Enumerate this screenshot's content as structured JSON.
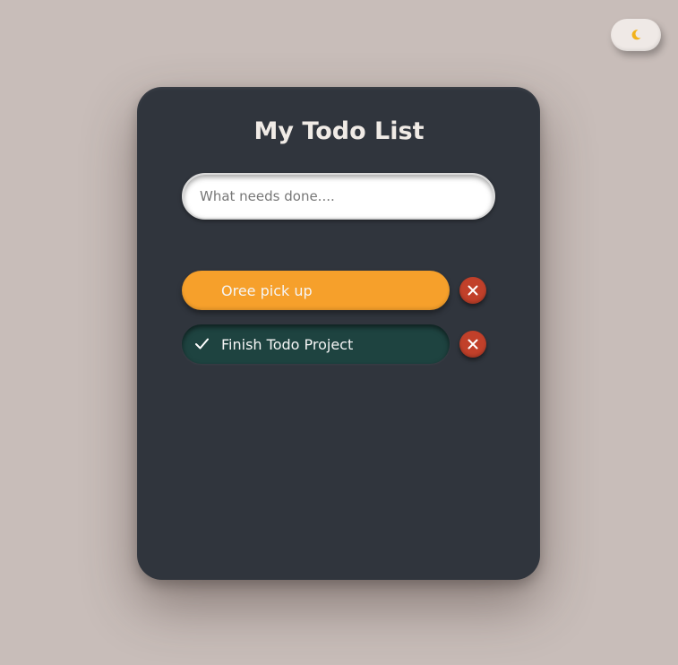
{
  "app": {
    "title": "My Todo List"
  },
  "theme_toggle": {
    "icon": "moon-icon",
    "icon_color": "#f2b21b"
  },
  "input": {
    "placeholder": "What needs done....",
    "value": ""
  },
  "todos": [
    {
      "text": "Oree pick up",
      "completed": false,
      "color": "#f6a02b",
      "delete_icon": "close-icon"
    },
    {
      "text": "Finish Todo Project",
      "completed": true,
      "color": "#1e4340",
      "check_icon": "check-icon",
      "delete_icon": "close-icon"
    }
  ],
  "colors": {
    "background": "#c8bdb9",
    "card": "#30353d",
    "delete_button": "#c1402a"
  }
}
